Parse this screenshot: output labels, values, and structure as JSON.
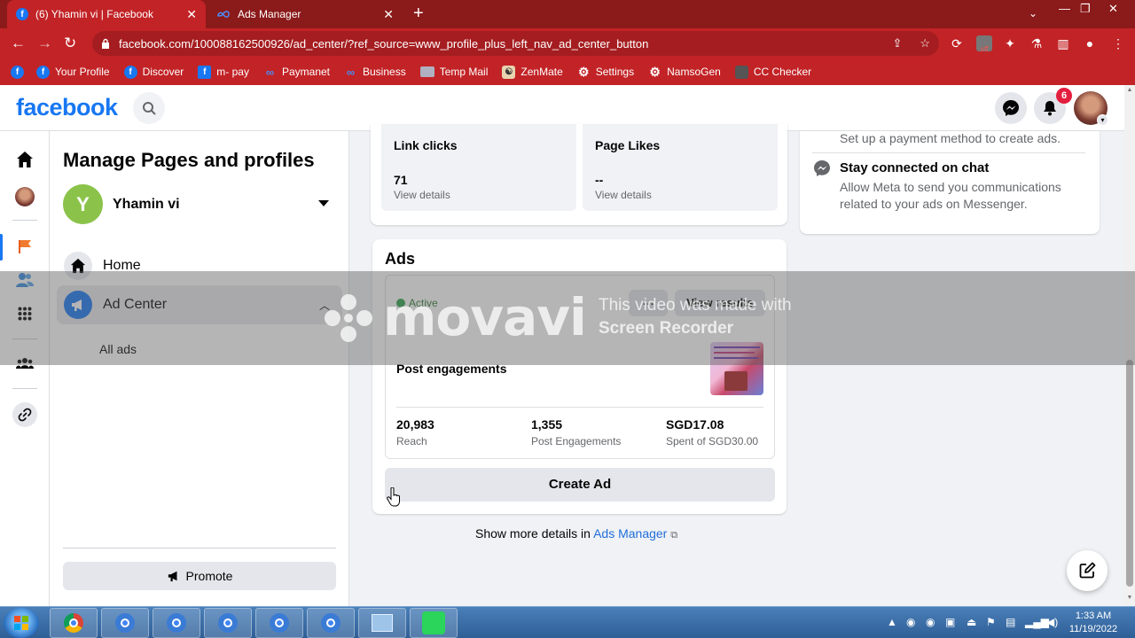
{
  "browser": {
    "tabs": [
      {
        "title": "(6) Yhamin vi | Facebook",
        "active": true
      },
      {
        "title": "Ads Manager",
        "active": false
      }
    ],
    "url": "facebook.com/100088162500926/ad_center/?ref_source=www_profile_plus_left_nav_ad_center_button",
    "bookmarks": [
      "Your Profile",
      "Discover",
      "m- pay",
      "Paymanet",
      "Business",
      "Temp Mail",
      "ZenMate",
      "Settings",
      "NamsoGen",
      "CC Checker"
    ],
    "extension_badge": "off"
  },
  "header": {
    "logo": "facebook",
    "notification_count": "6"
  },
  "sidebar": {
    "title": "Manage Pages and profiles",
    "profile_initial": "Y",
    "profile_name": "Yhamin vi",
    "items": [
      {
        "label": "Home"
      },
      {
        "label": "Ad Center"
      }
    ],
    "sub_items": [
      {
        "label": "All ads"
      }
    ],
    "promote_label": "Promote"
  },
  "stats": [
    {
      "label": "Link clicks",
      "value": "71",
      "link": "View details"
    },
    {
      "label": "Page Likes",
      "value": "--",
      "link": "View details"
    }
  ],
  "ads": {
    "title": "Ads",
    "ad": {
      "status": "Active",
      "more_label": "...",
      "view_results_label": "View results",
      "name": "Post engagements",
      "metrics": [
        {
          "value": "20,983",
          "label": "Reach"
        },
        {
          "value": "1,355",
          "label": "Post Engagements"
        },
        {
          "value": "SGD17.08",
          "label": "Spent of SGD30.00"
        }
      ]
    },
    "create_ad_label": "Create Ad",
    "show_more_prefix": "Show more details in ",
    "show_more_link": "Ads Manager"
  },
  "right_panel": {
    "top_text": "Set up a payment method to create ads.",
    "chat_title": "Stay connected on chat",
    "chat_body": "Allow Meta to send you communications related to your ads on Messenger."
  },
  "watermark": {
    "brand": "movavi",
    "line1": "This video was made with",
    "line2": "Screen Recorder"
  },
  "taskbar": {
    "time": "1:33 AM",
    "date": "11/19/2022"
  },
  "colors": {
    "chrome_theme": "#c22326",
    "facebook_blue": "#1877f2",
    "active_green": "#31a24c"
  }
}
